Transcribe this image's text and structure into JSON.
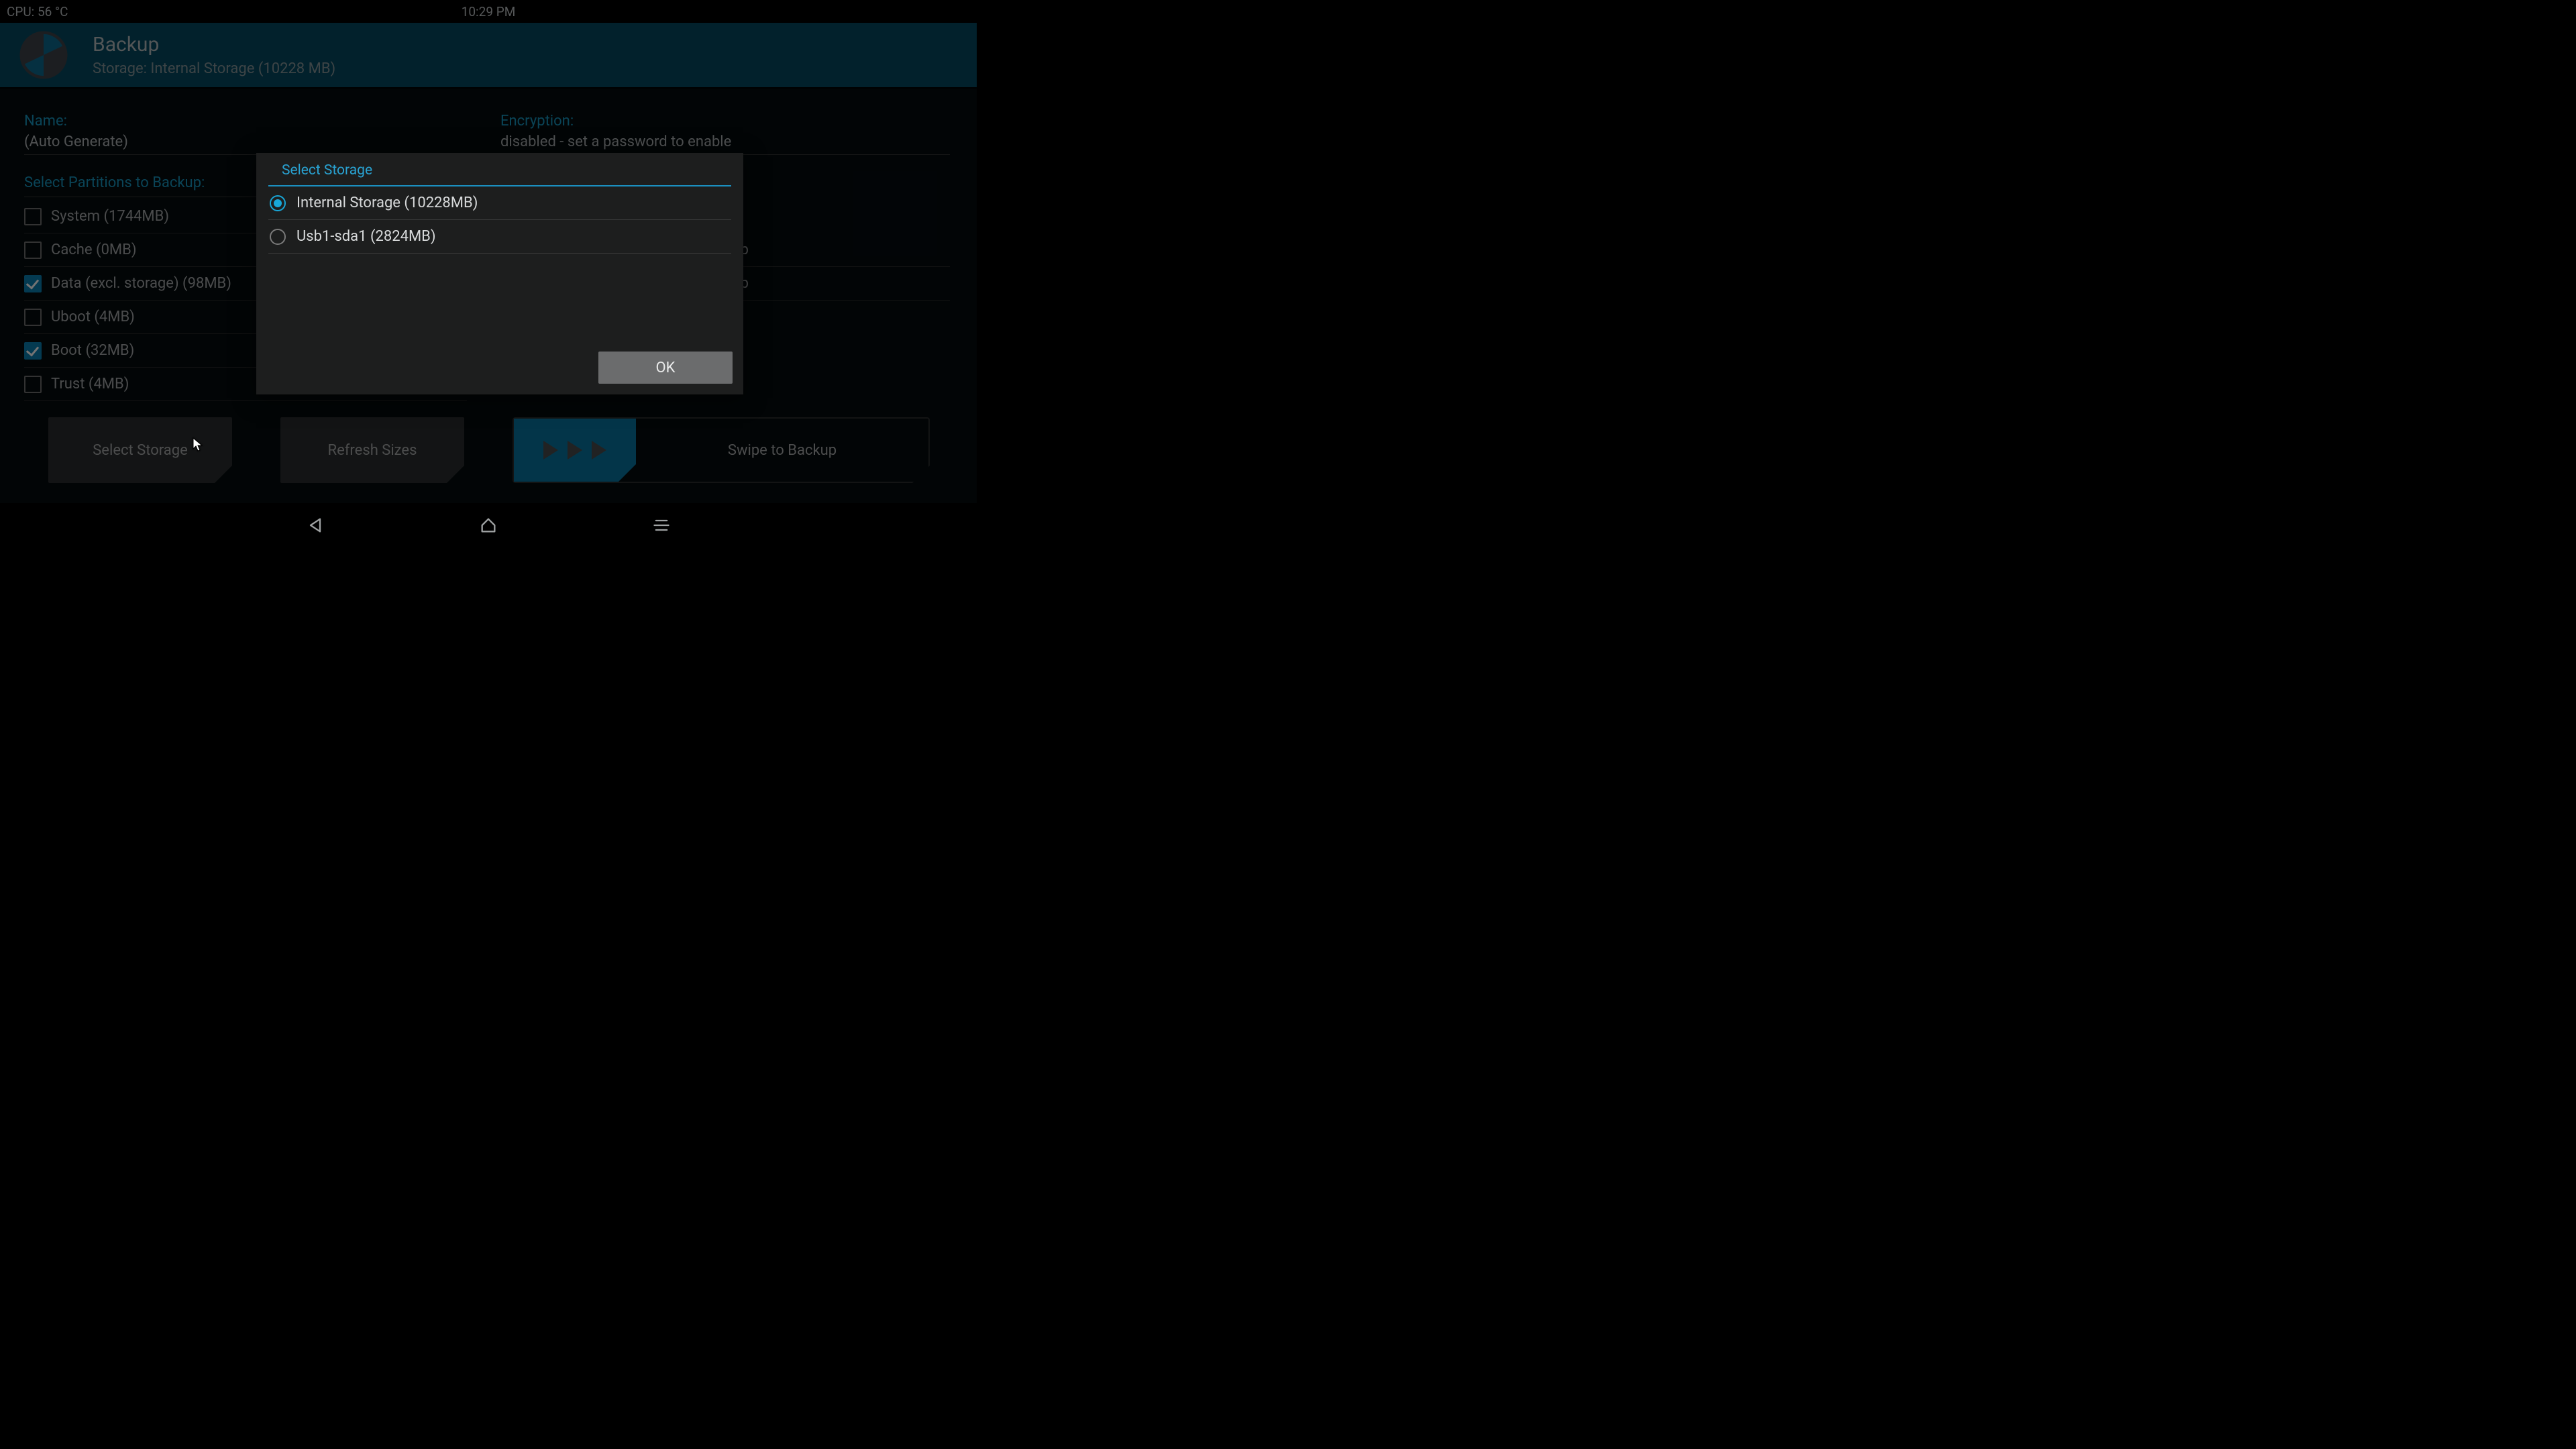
{
  "status": {
    "cpu": "CPU: 56 °C",
    "time": "10:29 PM"
  },
  "header": {
    "title": "Backup",
    "subtitle": "Storage: Internal Storage (10228 MB)"
  },
  "fields": {
    "name_label": "Name:",
    "name_value": "(Auto Generate)",
    "enc_label": "Encryption:",
    "enc_value": "disabled - set a password to enable"
  },
  "partitions_section_label": "Select Partitions to Backup:",
  "partitions": [
    {
      "label": "System (1744MB)",
      "checked": false
    },
    {
      "label": "Cache (0MB)",
      "checked": false
    },
    {
      "label": "Data (excl. storage) (98MB)",
      "checked": true
    },
    {
      "label": "Uboot (4MB)",
      "checked": false
    },
    {
      "label": "Boot (32MB)",
      "checked": true
    },
    {
      "label": "Trust (4MB)",
      "checked": false
    }
  ],
  "right_options": [
    {
      "tail": "p"
    },
    {
      "tail": "kup"
    }
  ],
  "buttons": {
    "select_storage": "Select Storage",
    "refresh_sizes": "Refresh Sizes",
    "swipe_label": "Swipe to Backup"
  },
  "dialog": {
    "title": "Select Storage",
    "options": [
      {
        "label": "Internal Storage (10228MB)",
        "selected": true
      },
      {
        "label": "Usb1-sda1 (2824MB)",
        "selected": false
      }
    ],
    "ok": "OK"
  }
}
